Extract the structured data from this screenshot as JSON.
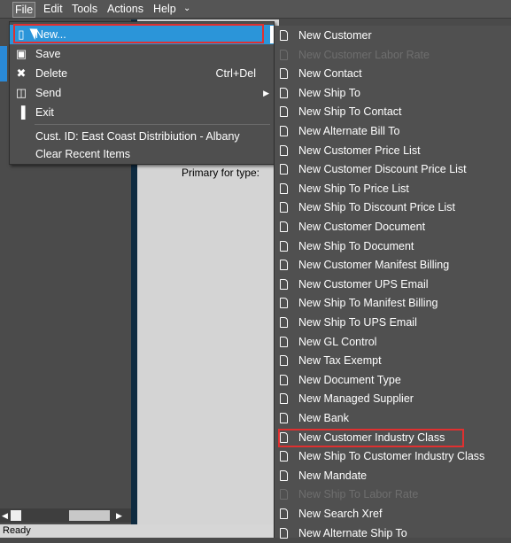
{
  "menubar": {
    "file": "File",
    "edit": "Edit",
    "tools": "Tools",
    "actions": "Actions",
    "help": "Help"
  },
  "file_menu": {
    "new": "New...",
    "save": "Save",
    "delete": "Delete",
    "delete_shortcut": "Ctrl+Del",
    "send": "Send",
    "exit": "Exit",
    "recent_item": "Cust. ID: East Coast Distribiution - Albany",
    "clear_recent": "Clear Recent Items"
  },
  "form": {
    "primary_for_type_label": "Primary for type:"
  },
  "new_submenu": {
    "items": [
      {
        "label": "New Customer",
        "enabled": true
      },
      {
        "label": "New Customer Labor Rate",
        "enabled": false
      },
      {
        "label": "New Contact",
        "enabled": true
      },
      {
        "label": "New Ship To",
        "enabled": true
      },
      {
        "label": "New Ship To Contact",
        "enabled": true
      },
      {
        "label": "New Alternate Bill To",
        "enabled": true
      },
      {
        "label": "New Customer Price List",
        "enabled": true
      },
      {
        "label": "New Customer Discount Price List",
        "enabled": true
      },
      {
        "label": "New Ship To Price List",
        "enabled": true
      },
      {
        "label": "New Ship To Discount Price List",
        "enabled": true
      },
      {
        "label": "New Customer Document",
        "enabled": true
      },
      {
        "label": "New Ship To Document",
        "enabled": true
      },
      {
        "label": "New Customer Manifest Billing",
        "enabled": true
      },
      {
        "label": "New Customer UPS Email",
        "enabled": true
      },
      {
        "label": "New Ship To Manifest Billing",
        "enabled": true
      },
      {
        "label": "New Ship To UPS Email",
        "enabled": true
      },
      {
        "label": "New GL Control",
        "enabled": true
      },
      {
        "label": "New Tax Exempt",
        "enabled": true
      },
      {
        "label": "New Document Type",
        "enabled": true
      },
      {
        "label": "New Managed Supplier",
        "enabled": true
      },
      {
        "label": "New Bank",
        "enabled": true
      },
      {
        "label": "New Customer Industry Class",
        "enabled": true
      },
      {
        "label": "New Ship To Customer Industry Class",
        "enabled": true
      },
      {
        "label": "New Mandate",
        "enabled": true
      },
      {
        "label": "New Ship To Labor Rate",
        "enabled": false
      },
      {
        "label": "New Search Xref",
        "enabled": true
      },
      {
        "label": "New Alternate Ship To",
        "enabled": true
      }
    ]
  },
  "status": {
    "text": "Ready"
  },
  "colors": {
    "highlight_blue": "#2b95d9",
    "annotation_red": "#e03030"
  }
}
